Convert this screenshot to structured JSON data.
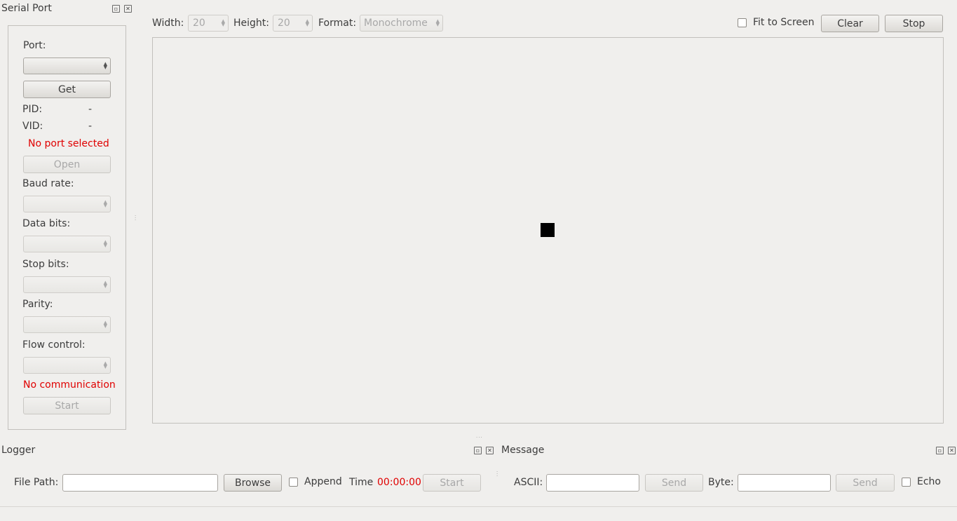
{
  "serial_port": {
    "title": "Serial Port",
    "port_label": "Port:",
    "get_label": "Get",
    "pid_label": "PID:",
    "pid_value": "-",
    "vid_label": "VID:",
    "vid_value": "-",
    "port_status": "No port selected",
    "open_label": "Open",
    "baud_label": "Baud rate:",
    "data_bits_label": "Data bits:",
    "stop_bits_label": "Stop bits:",
    "parity_label": "Parity:",
    "flow_label": "Flow control:",
    "comm_status": "No communication",
    "start_label": "Start"
  },
  "toolbar": {
    "width_label": "Width:",
    "width_value": "20",
    "height_label": "Height:",
    "height_value": "20",
    "format_label": "Format:",
    "format_value": "Monochrome",
    "fit_label": "Fit to Screen",
    "clear_label": "Clear",
    "stop_label": "Stop"
  },
  "logger": {
    "title": "Logger",
    "file_path_label": "File Path:",
    "file_path_value": "",
    "browse_label": "Browse",
    "append_label": "Append",
    "time_label": "Time",
    "time_value": "00:00:00",
    "start_label": "Start"
  },
  "message": {
    "title": "Message",
    "ascii_label": "ASCII:",
    "ascii_value": "",
    "send_ascii_label": "Send",
    "byte_label": "Byte:",
    "byte_value": "",
    "send_byte_label": "Send",
    "echo_label": "Echo"
  },
  "colors": {
    "status_red": "#e00000",
    "window_bg": "#f0efed"
  },
  "icons": {
    "float": "float-icon",
    "close": "close-icon"
  }
}
